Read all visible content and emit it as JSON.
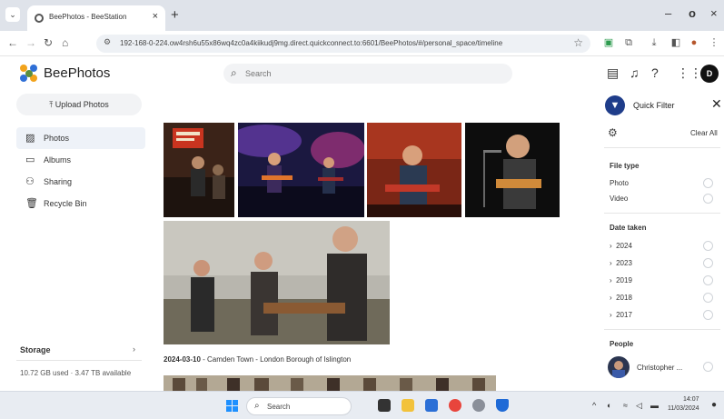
{
  "browser": {
    "tab_title": "BeePhotos - BeeStation",
    "new_tab": "+",
    "tab_close": "×",
    "url": "192-168-0-224.ow4rsh6u55x86wq4zc0a4kiikudj9mg.direct.quickconnect.to:6601/BeePhotos/#/personal_space/timeline",
    "window_minimize": "–",
    "window_maximize": "o",
    "window_close": "×"
  },
  "app": {
    "brand": "BeePhotos",
    "search_placeholder": "Search",
    "avatar_initial": "D"
  },
  "sidebar": {
    "upload_label": "Upload Photos",
    "items": [
      {
        "label": "Photos",
        "icon": "image-icon",
        "active": true
      },
      {
        "label": "Albums",
        "icon": "album-icon",
        "active": false
      },
      {
        "label": "Sharing",
        "icon": "people-icon",
        "active": false
      },
      {
        "label": "Recycle Bin",
        "icon": "trash-icon",
        "active": false
      }
    ],
    "storage_title": "Storage",
    "storage_text": "10.72 GB used · 3.47 TB available"
  },
  "timeline": {
    "date": "2024-03-10",
    "location": " - Camden Town - London Borough of Islington"
  },
  "filter": {
    "title": "Quick Filter",
    "clear_all": "Clear All",
    "file_type_title": "File type",
    "file_types": [
      "Photo",
      "Video"
    ],
    "date_taken_title": "Date taken",
    "years": [
      "2024",
      "2023",
      "2019",
      "2018",
      "2017"
    ],
    "people_title": "People",
    "person_name": "Christopher ..."
  },
  "taskbar": {
    "search_label": "Search",
    "time": "14:07",
    "date": "11/03/2024"
  },
  "colors": {
    "accent": "#1f3d8a",
    "active_nav": "#eef2f8",
    "windows_blue": "#1e90ff"
  }
}
